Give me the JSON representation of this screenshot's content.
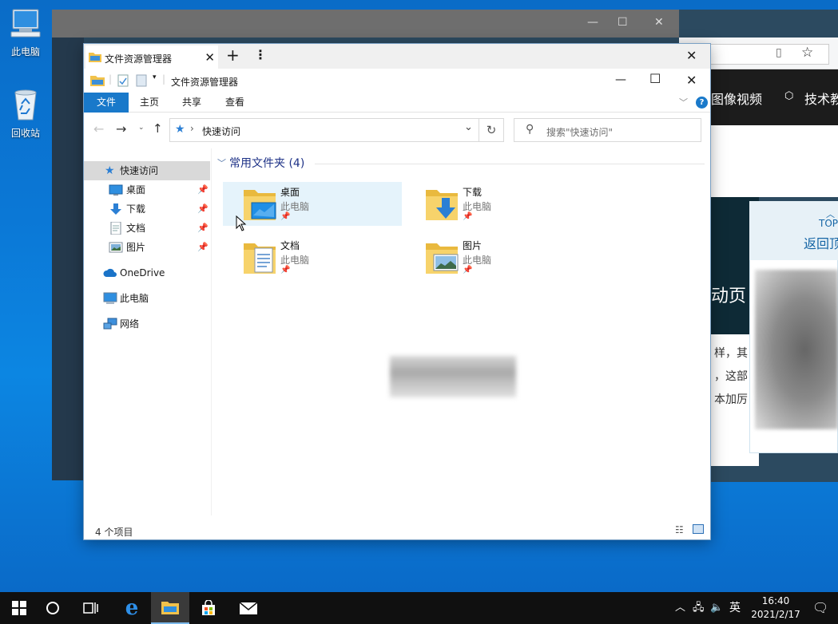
{
  "desktop": {
    "icons": [
      {
        "label": "此电脑",
        "icon": "computer-icon"
      },
      {
        "label": "回收站",
        "icon": "recycle-bin-icon"
      }
    ]
  },
  "background_browser": {
    "nav_items": [
      "图像视频",
      "技术教"
    ],
    "banner_text": "动页",
    "body_text": [
      "样，其",
      "，这部",
      "本加厉"
    ],
    "top_button": "TOP",
    "back_to_top": "返回顶"
  },
  "explorer": {
    "tab_title": "文件资源管理器",
    "window_title": "文件资源管理器",
    "ribbon_tabs": [
      "文件",
      "主页",
      "共享",
      "查看"
    ],
    "address": {
      "location": "快速访问"
    },
    "search": {
      "placeholder": "搜索\"快速访问\""
    },
    "nav": {
      "quick_access": "快速访问",
      "pinned": [
        "桌面",
        "下载",
        "文档",
        "图片"
      ],
      "onedrive": "OneDrive",
      "this_pc": "此电脑",
      "network": "网络"
    },
    "group": {
      "header": "常用文件夹 (4)"
    },
    "folders": [
      {
        "name": "桌面",
        "location": "此电脑",
        "icon": "desktop-folder-icon"
      },
      {
        "name": "下载",
        "location": "此电脑",
        "icon": "downloads-folder-icon"
      },
      {
        "name": "文档",
        "location": "此电脑",
        "icon": "documents-folder-icon"
      },
      {
        "name": "图片",
        "location": "此电脑",
        "icon": "pictures-folder-icon"
      }
    ],
    "status": {
      "item_count": "4 个项目"
    }
  },
  "taskbar": {
    "ime": "英",
    "time": "16:40",
    "date": "2021/2/17"
  },
  "colors": {
    "accent": "#1979ca",
    "selection": "#e5f3fb",
    "nav_selected": "#d9d9d9",
    "group_header": "#1e3287",
    "taskbar": "#101010"
  }
}
